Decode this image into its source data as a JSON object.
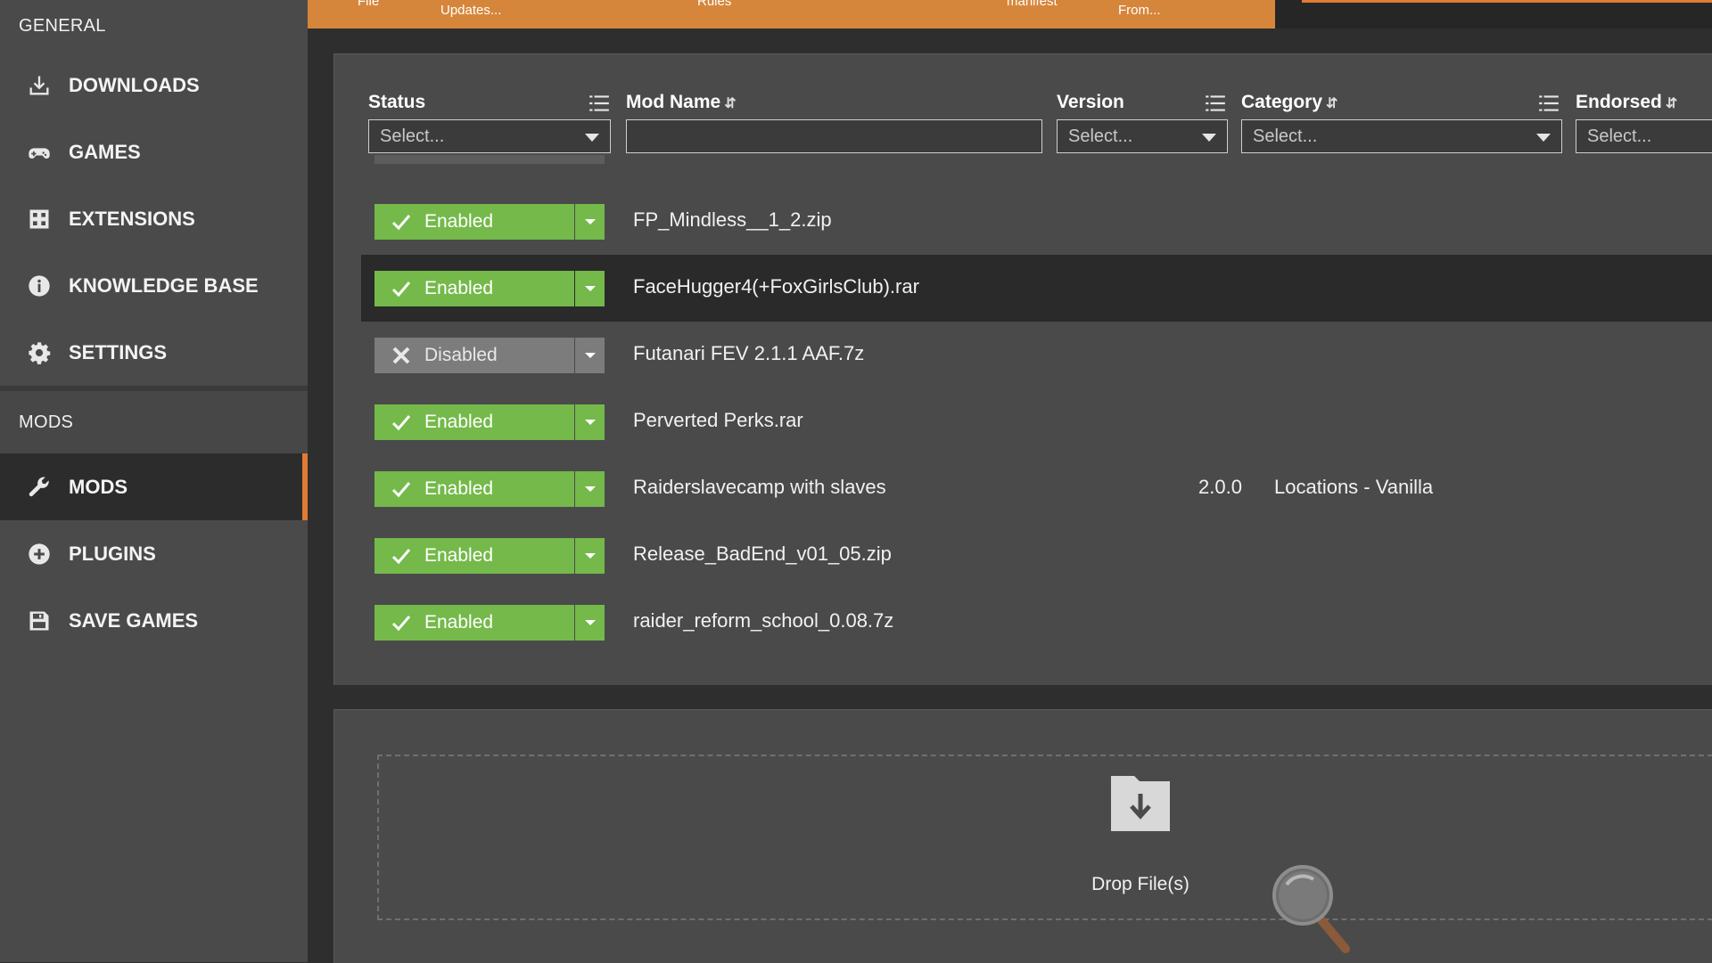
{
  "sidebar": {
    "general_header": "GENERAL",
    "general_items": [
      {
        "label": "DOWNLOADS",
        "icon": "download-icon"
      },
      {
        "label": "GAMES",
        "icon": "gamepad-icon"
      },
      {
        "label": "EXTENSIONS",
        "icon": "extensions-icon"
      },
      {
        "label": "KNOWLEDGE BASE",
        "icon": "info-icon"
      },
      {
        "label": "SETTINGS",
        "icon": "gear-icon"
      }
    ],
    "mods_header": "MODS",
    "mods_items": [
      {
        "label": "MODS",
        "icon": "wrench-icon",
        "active": true
      },
      {
        "label": "PLUGINS",
        "icon": "plus-circle-icon"
      },
      {
        "label": "SAVE GAMES",
        "icon": "floppy-icon"
      }
    ]
  },
  "toolbar": {
    "buttons": [
      "File",
      "Updates...",
      "Rules",
      "manifest",
      "From..."
    ]
  },
  "table": {
    "columns": {
      "status": "Status",
      "mod_name": "Mod Name",
      "version": "Version",
      "category": "Category",
      "endorsed": "Endorsed"
    },
    "filters": {
      "status_placeholder": "Select...",
      "mod_name_value": "",
      "version_placeholder": "Select...",
      "category_placeholder": "Select...",
      "endorsed_placeholder": "Select..."
    },
    "rows": [
      {
        "status": "Enabled",
        "name": "FP_Mindless__1_2.zip",
        "version": "",
        "category": ""
      },
      {
        "status": "Enabled",
        "name": "FaceHugger4(+FoxGirlsClub).rar",
        "version": "",
        "category": "",
        "selected": true
      },
      {
        "status": "Disabled",
        "name": "Futanari FEV 2.1.1 AAF.7z",
        "version": "",
        "category": ""
      },
      {
        "status": "Enabled",
        "name": "Perverted Perks.rar",
        "version": "",
        "category": ""
      },
      {
        "status": "Enabled",
        "name": "Raiderslavecamp with slaves",
        "version": "2.0.0",
        "category": "Locations - Vanilla"
      },
      {
        "status": "Enabled",
        "name": "Release_BadEnd_v01_05.zip",
        "version": "",
        "category": ""
      },
      {
        "status": "Enabled",
        "name": "raider_reform_school_0.08.7z",
        "version": "",
        "category": ""
      }
    ]
  },
  "drop_zone": {
    "label": "Drop File(s)"
  },
  "colors": {
    "accent": "#e07a34",
    "toolbar": "#d6863b",
    "enabled": "#74b94a",
    "disabled": "#7c7c7c",
    "sidebar": "#4a4a4a",
    "background": "#2e2e2e"
  }
}
